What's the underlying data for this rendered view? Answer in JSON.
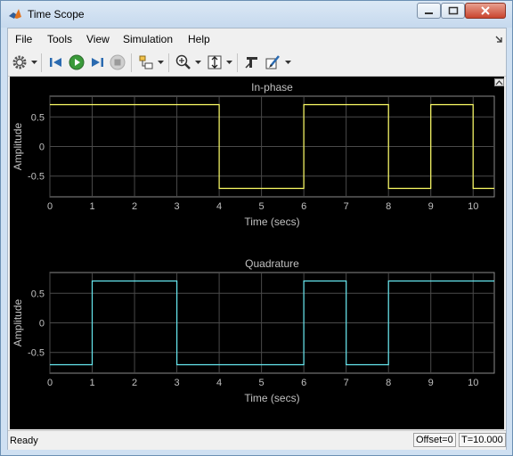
{
  "window": {
    "title": "Time Scope"
  },
  "menu": [
    "File",
    "Tools",
    "View",
    "Simulation",
    "Help"
  ],
  "toolbar_icons": [
    "configuration-properties",
    "step-back",
    "run",
    "step-forward",
    "stop",
    "signal-selection",
    "zoom-in",
    "scale-axes",
    "highlight-block",
    "style"
  ],
  "status": {
    "text": "Ready",
    "offset": "Offset=0",
    "time": "T=10.000"
  },
  "colors": {
    "inphase": "#ffff66",
    "quadrature": "#66e8f0",
    "axes_bg": "#000000",
    "figure_bg": "#000000",
    "grid": "#4a4a4a",
    "text": "#c0c0c0"
  },
  "chart_data": [
    {
      "type": "line",
      "title": "In-phase",
      "xlabel": "Time (secs)",
      "ylabel": "Amplitude",
      "xlim": [
        0,
        10.5
      ],
      "ylim": [
        -0.85,
        0.85
      ],
      "xticks": [
        0,
        1,
        2,
        3,
        4,
        5,
        6,
        7,
        8,
        9,
        10
      ],
      "yticks": [
        -0.5,
        0,
        0.5
      ],
      "ytick_labels": [
        "-0.5",
        "0",
        "0.5"
      ],
      "grid": true,
      "series": [
        {
          "x": [
            0,
            4,
            4,
            6,
            6,
            8,
            8,
            9,
            9,
            10,
            10,
            10.5
          ],
          "y": [
            0.707,
            0.707,
            -0.707,
            -0.707,
            0.707,
            0.707,
            -0.707,
            -0.707,
            0.707,
            0.707,
            -0.707,
            -0.707
          ]
        }
      ]
    },
    {
      "type": "line",
      "title": "Quadrature",
      "xlabel": "Time (secs)",
      "ylabel": "Amplitude",
      "xlim": [
        0,
        10.5
      ],
      "ylim": [
        -0.85,
        0.85
      ],
      "xticks": [
        0,
        1,
        2,
        3,
        4,
        5,
        6,
        7,
        8,
        9,
        10
      ],
      "yticks": [
        -0.5,
        0,
        0.5
      ],
      "ytick_labels": [
        "-0.5",
        "0",
        "0.5"
      ],
      "grid": true,
      "series": [
        {
          "x": [
            0,
            1,
            1,
            3,
            3,
            6,
            6,
            7,
            7,
            8,
            8,
            10.5
          ],
          "y": [
            -0.707,
            -0.707,
            0.707,
            0.707,
            -0.707,
            -0.707,
            0.707,
            0.707,
            -0.707,
            -0.707,
            0.707,
            0.707
          ]
        }
      ]
    }
  ]
}
